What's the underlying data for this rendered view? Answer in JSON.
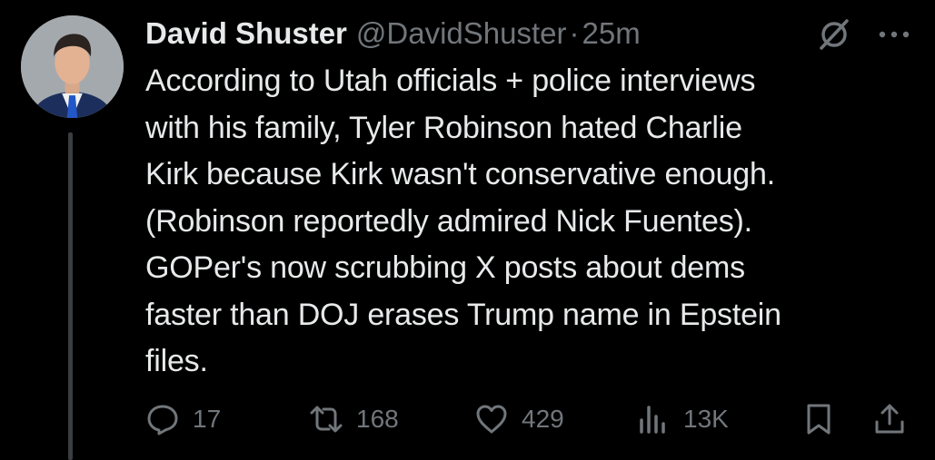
{
  "author": {
    "display_name": "David Shuster",
    "handle": "@DavidShuster",
    "separator": "·",
    "time": "25m"
  },
  "tweet": {
    "text": "According to Utah officials + police interviews\nwith his family, Tyler Robinson hated Charlie\nKirk because Kirk wasn't conservative enough.\n(Robinson reportedly admired Nick Fuentes).\nGOPer's now scrubbing X posts about dems\nfaster than DOJ erases Trump name in Epstein\nfiles."
  },
  "actions": {
    "replies": "17",
    "reposts": "168",
    "likes": "429",
    "views": "13K"
  },
  "icons": {
    "header": [
      "grok-icon",
      "more-icon"
    ],
    "actions": [
      "reply-icon",
      "repost-icon",
      "like-icon",
      "views-icon",
      "bookmark-icon",
      "share-icon"
    ]
  },
  "colors": {
    "background": "#000000",
    "text": "#e7e9ea",
    "secondary": "#71767b",
    "thread_line": "#3a3d41"
  }
}
